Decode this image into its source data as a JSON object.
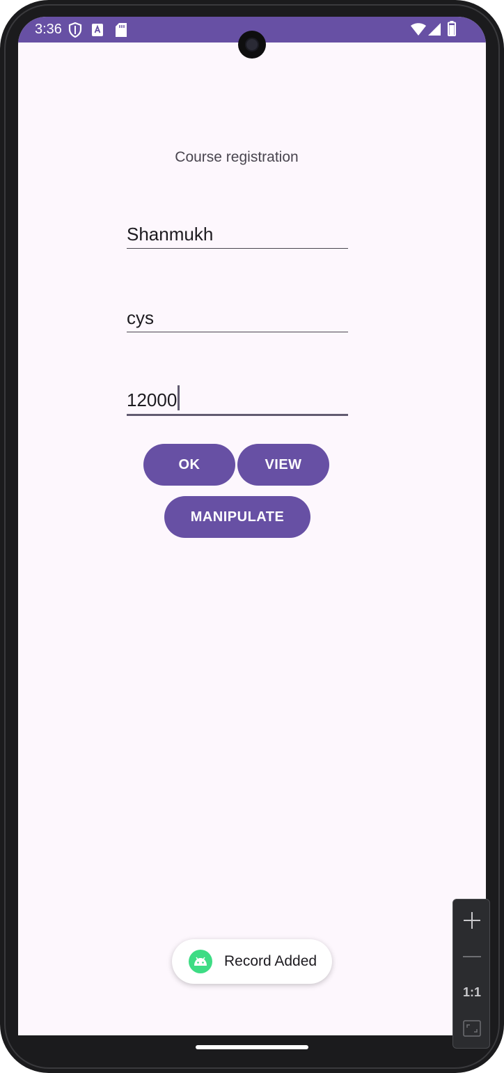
{
  "status_bar": {
    "time": "3:36",
    "icons": [
      "shield-icon",
      "keyboard-a-icon",
      "sd-card-icon",
      "wifi-icon",
      "cell-signal-icon",
      "battery-icon"
    ],
    "color": "#6750a4"
  },
  "screen": {
    "title": "Course registration",
    "fields": [
      {
        "name": "student-name",
        "value": "Shanmukh"
      },
      {
        "name": "course",
        "value": "cys"
      },
      {
        "name": "fee",
        "value": "12000",
        "focused": true
      }
    ],
    "buttons": {
      "ok_label": "OK",
      "view_label": "VIEW",
      "manipulate_label": "MANIPULATE"
    },
    "accent_color": "#6750a4"
  },
  "toast": {
    "icon": "android-icon",
    "message": "Record Added"
  },
  "zoom_panel": {
    "icons": [
      "plus-icon",
      "minus-icon",
      "fit-screen-icon"
    ],
    "ratio_label": "1:1"
  }
}
